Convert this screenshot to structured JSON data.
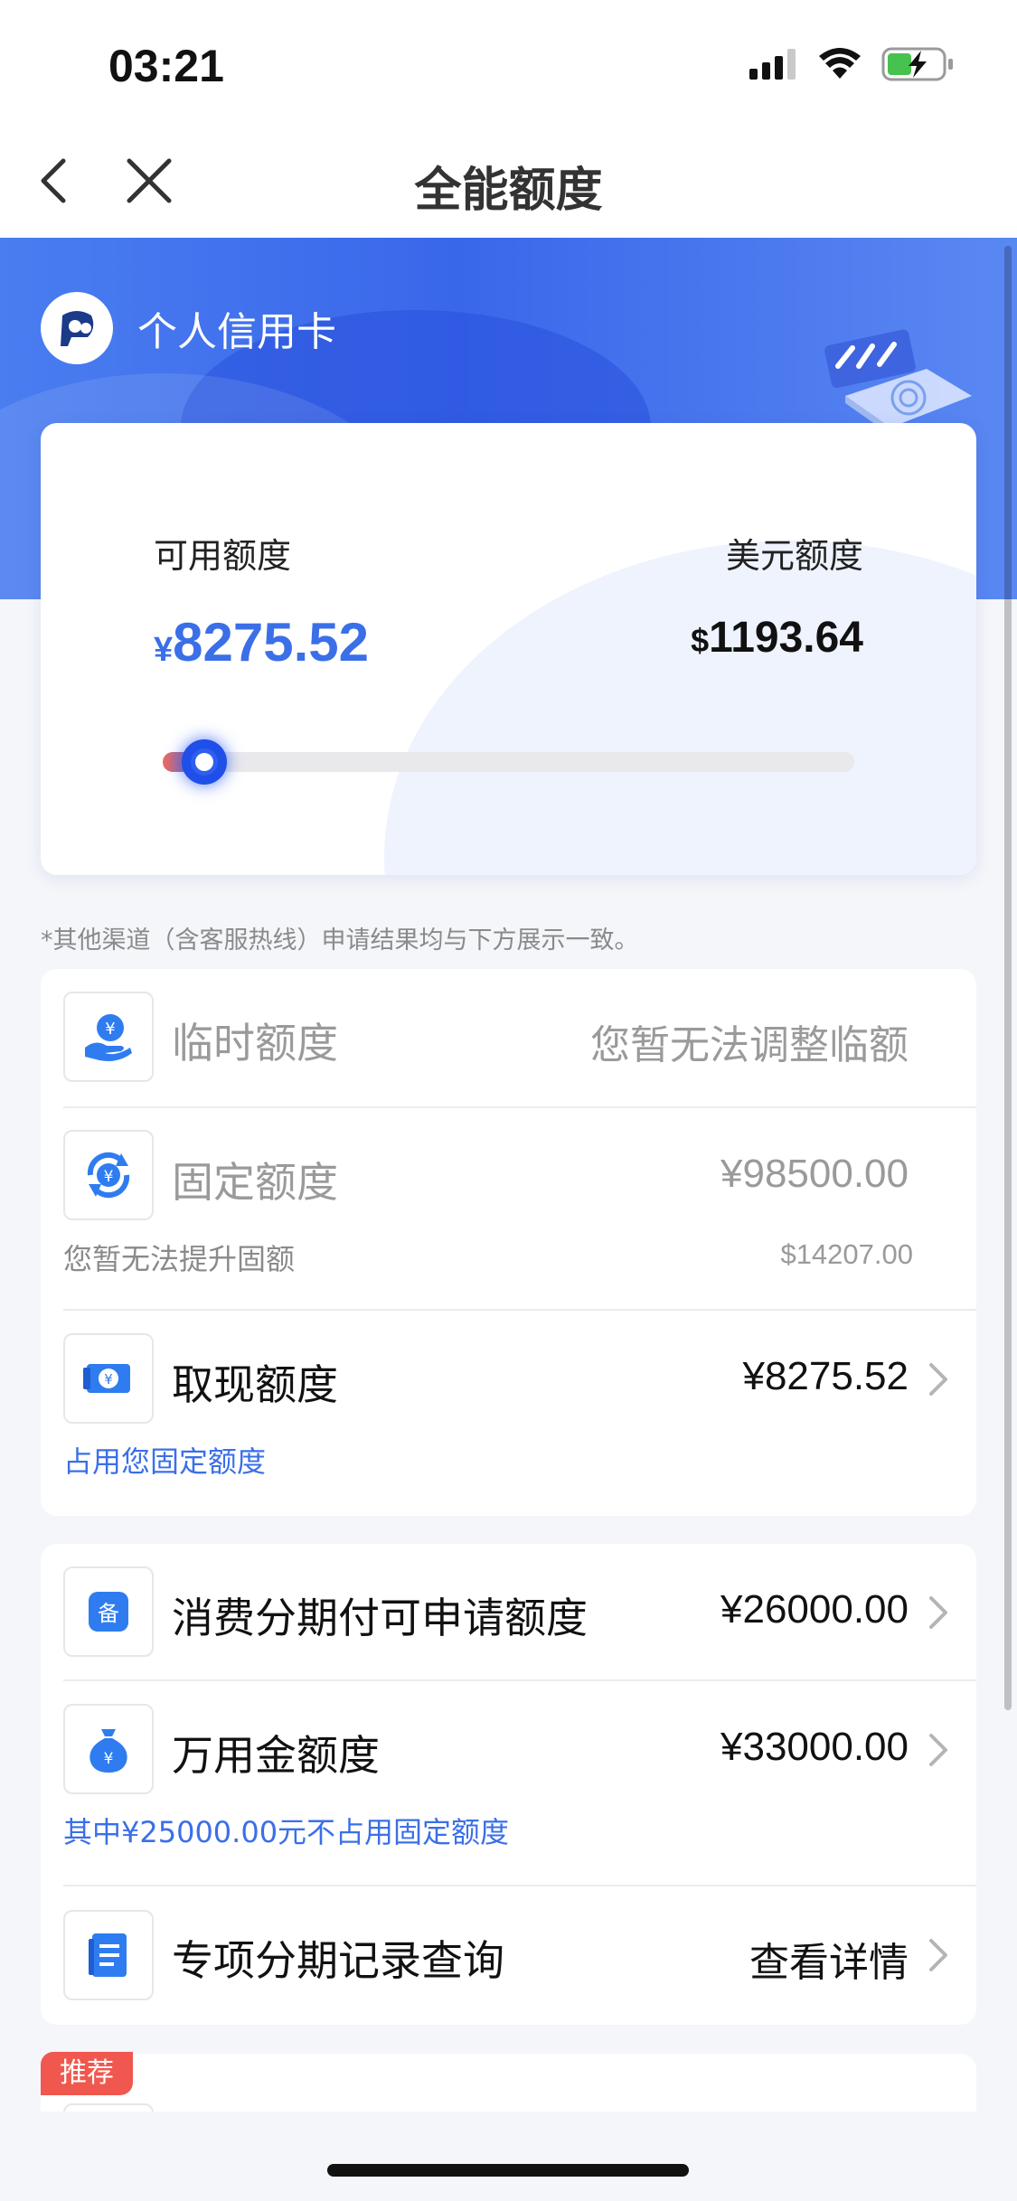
{
  "status_bar": {
    "time": "03:21"
  },
  "nav": {
    "title": "全能额度"
  },
  "card": {
    "type": "个人信用卡"
  },
  "limits": {
    "available_label": "可用额度",
    "available_currency": "¥",
    "available_value": "8275.52",
    "usd_label": "美元额度",
    "usd_currency": "$",
    "usd_value": "1193.64",
    "used_fraction": 0.06
  },
  "disclaimer": "*其他渠道（含客服热线）申请结果均与下方展示一致。",
  "section1": {
    "temp": {
      "label": "临时额度",
      "value": "您暂无法调整临额"
    },
    "fixed": {
      "label": "固定额度",
      "value": "¥98500.00",
      "note": "您暂无法提升固额",
      "usd": "$14207.00"
    },
    "cash": {
      "label": "取现额度",
      "value": "¥8275.52",
      "note": "占用您固定额度"
    }
  },
  "section2": {
    "installment": {
      "label": "消费分期付可申请额度",
      "value": "¥26000.00"
    },
    "wanyongjin": {
      "label": "万用金额度",
      "value": "¥33000.00",
      "note": "其中¥25000.00元不占用固定额度"
    },
    "special": {
      "label": "专项分期记录查询",
      "value": "查看详情"
    }
  },
  "recommend": {
    "badge": "推荐"
  },
  "colors": {
    "accent": "#3b6fe8",
    "hero": "#4a7df0",
    "badge": "#f0584f"
  }
}
